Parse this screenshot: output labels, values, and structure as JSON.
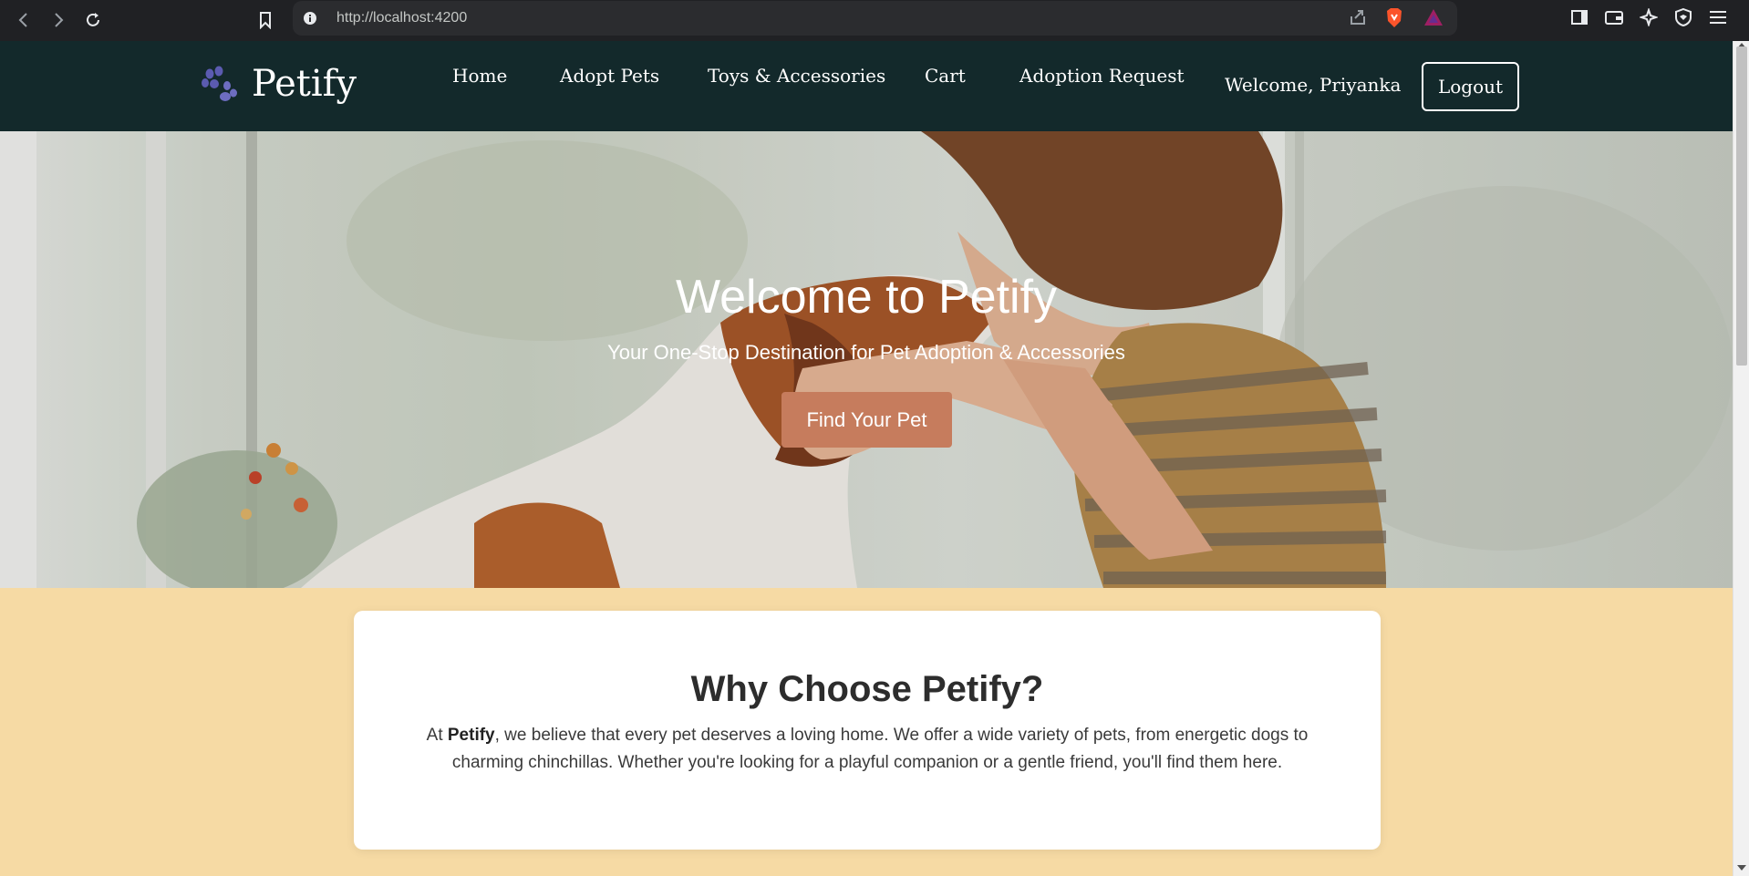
{
  "browser": {
    "url": "http://localhost:4200",
    "icons": [
      "back-icon",
      "forward-icon",
      "reload-icon",
      "bookmark-icon",
      "info-icon",
      "share-icon",
      "brave-shield-icon",
      "bat-rewards-icon",
      "sidebar-icon",
      "wallet-icon",
      "leo-icon",
      "vpn-icon",
      "menu-icon"
    ]
  },
  "nav": {
    "brand": "Petify",
    "brand_icon": "paw-icon",
    "links": [
      "Home",
      "Adopt Pets",
      "Toys & Accessories",
      "Cart",
      "Adoption Request"
    ],
    "welcome": "Welcome, Priyanka",
    "logout": "Logout"
  },
  "hero": {
    "title": "Welcome to Petify",
    "subtitle": "Your One-Stop Destination for Pet Adoption & Accessories",
    "cta": "Find Your Pet"
  },
  "why": {
    "title": "Why Choose Petify?",
    "text_prefix": "At ",
    "text_bold": "Petify",
    "text_rest": ", we believe that every pet deserves a loving home. We offer a wide variety of pets, from energetic dogs to charming chinchillas. Whether you're looking for a playful companion or a gentle friend, you'll find them here."
  },
  "colors": {
    "nav_bg": "#13292b",
    "page_bg": "#f6daa4",
    "cta_bg": "#c67c5d",
    "paw": "#5b5bb0"
  }
}
